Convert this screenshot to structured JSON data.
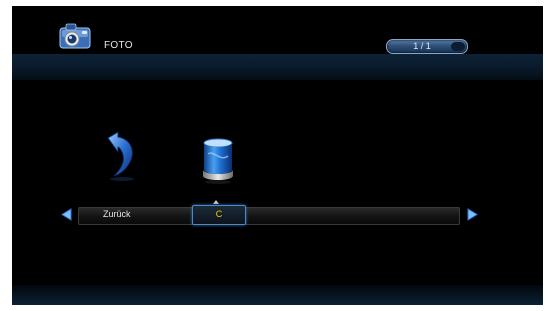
{
  "header": {
    "app_icon": "camera-icon",
    "title": "FOTO",
    "page_indicator": "1 / 1"
  },
  "tiles": [
    {
      "icon": "back-arrow-icon",
      "label": "Zurück"
    },
    {
      "icon": "drive-icon",
      "label": "C"
    }
  ],
  "nav": {
    "prev_icon": "arrow-left-icon",
    "next_icon": "arrow-right-icon"
  },
  "colors": {
    "background": "#000000",
    "accent_blue": "#4d88c8",
    "selected_text": "#f2d000",
    "text": "#e6e6e6"
  }
}
